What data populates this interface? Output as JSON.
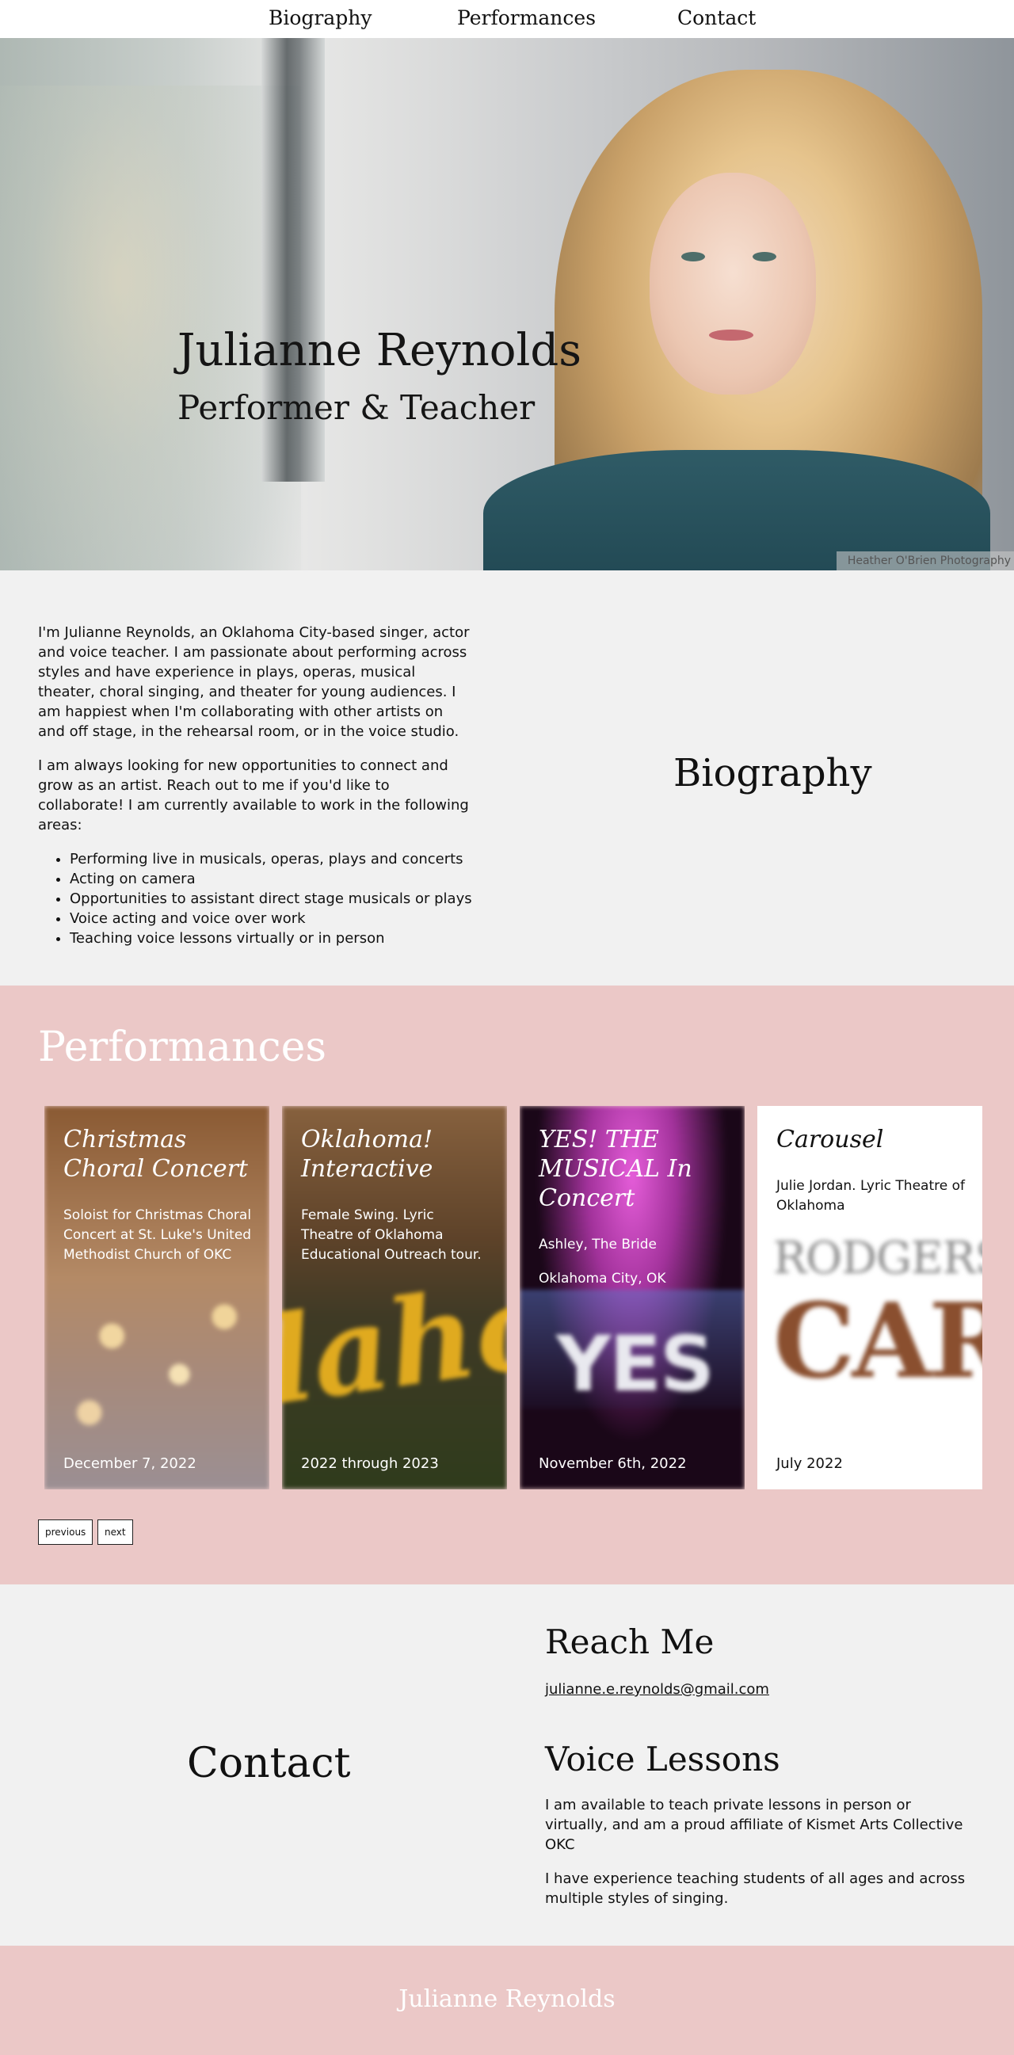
{
  "nav": {
    "items": [
      "Biography",
      "Performances",
      "Contact"
    ]
  },
  "hero": {
    "name": "Julianne Reynolds",
    "subtitle": "Performer & Teacher",
    "photo_credit": "Heather O'Brien Photography"
  },
  "biography": {
    "heading": "Biography",
    "paragraphs": [
      "I'm Julianne Reynolds, an Oklahoma City-based singer, actor and voice teacher. I am passionate about performing across styles and have experience in plays, operas, musical theater, choral singing, and theater for young audiences. I am happiest when I'm collaborating with other artists on and off stage, in the rehearsal room, or in the voice studio.",
      "I am always looking for new opportunities to connect and grow as an artist. Reach out to me if you'd like to collaborate! I am currently available to work in the following areas:"
    ],
    "areas": [
      "Performing live in musicals, operas, plays and concerts",
      "Acting on camera",
      "Opportunities to assistant direct stage musicals or plays",
      "Voice acting and voice over work",
      "Teaching voice lessons virtually or in person"
    ]
  },
  "performances": {
    "heading": "Performances",
    "cards": [
      {
        "title": "Christmas Choral Concert",
        "lines": [
          "Soloist for Christmas Choral Concert at St. Luke's United Methodist Church of OKC"
        ],
        "date": "December 7, 2022"
      },
      {
        "title": "Oklahoma! Interactive",
        "lines": [
          "Female Swing. Lyric Theatre of Oklahoma Educational Outreach tour."
        ],
        "date": "2022 through 2023"
      },
      {
        "title": "YES! THE MUSICAL In Concert",
        "lines": [
          "Ashley, The Bride",
          "Oklahoma City, OK"
        ],
        "date": "November 6th, 2022"
      },
      {
        "title": "Carousel",
        "lines": [
          "Julie Jordan. Lyric Theatre of Oklahoma"
        ],
        "date": "July 2022"
      }
    ],
    "previous_label": "previous",
    "next_label": "next"
  },
  "contact": {
    "heading": "Contact",
    "reach_heading": "Reach Me",
    "email": "julianne.e.reynolds@gmail.com",
    "lessons_heading": "Voice Lessons",
    "lessons_paragraphs": [
      "I am available to teach private lessons in person or virtually, and am a proud affiliate of Kismet Arts Collective OKC",
      "I have experience teaching students of all ages and across multiple styles of singing."
    ]
  },
  "footer": {
    "name": "Julianne Reynolds"
  },
  "colors": {
    "pink": "#ebc8c7",
    "background": "#f1f1f1"
  }
}
